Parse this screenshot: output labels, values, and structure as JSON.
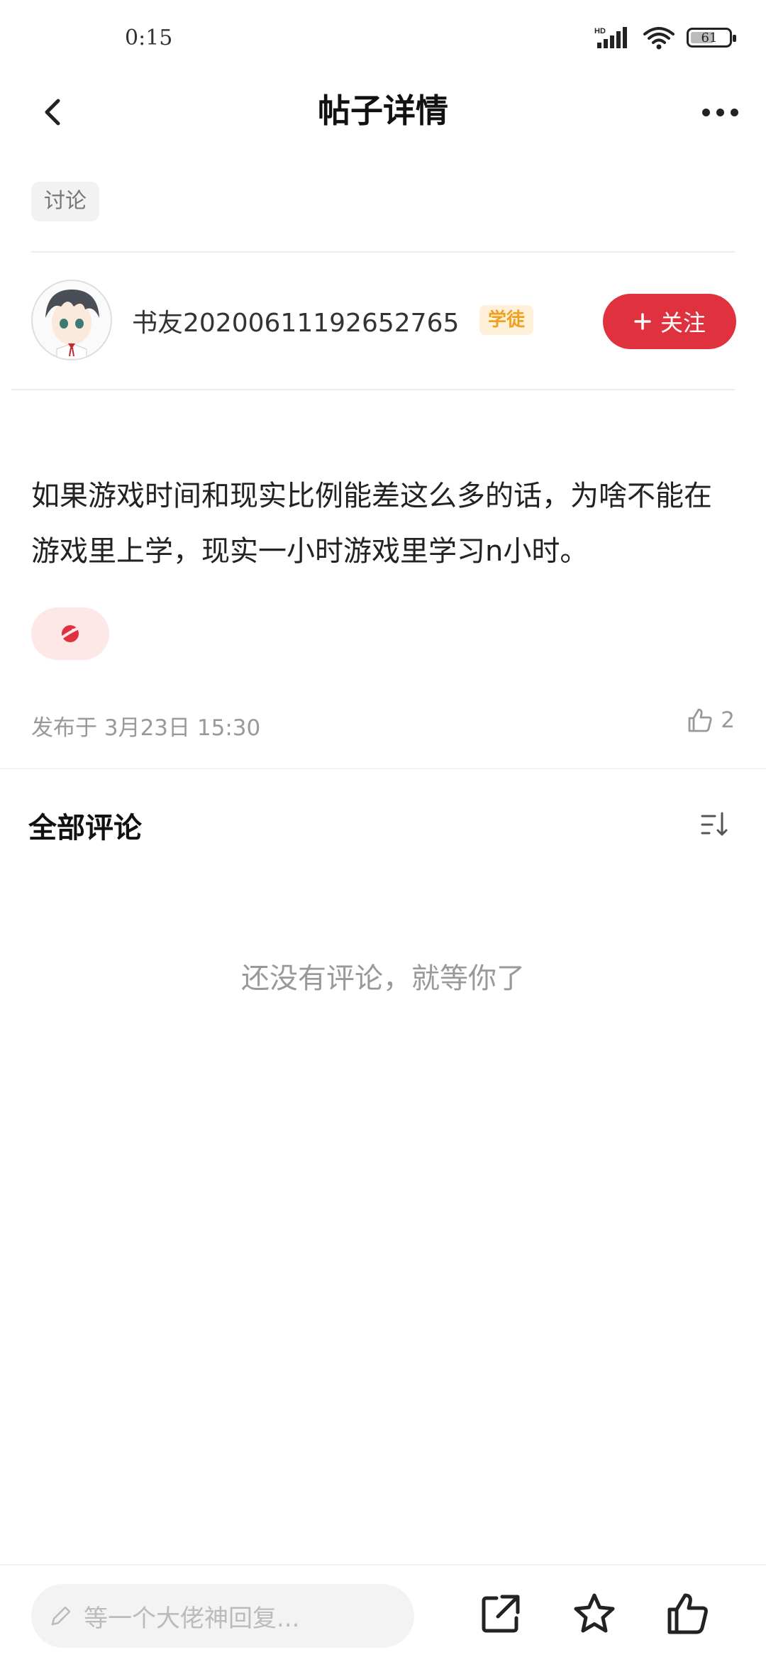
{
  "status_bar": {
    "time": "0:15",
    "network_label": "HD",
    "battery": "61",
    "battery_level": 0.61
  },
  "header": {
    "title": "帖子详情"
  },
  "post": {
    "tag": "讨论",
    "author": {
      "name": "书友20200611192652765",
      "badge": "学徒",
      "follow_label": "关注"
    },
    "content": "如果游戏时间和现实比例能差这么多的话，为啥不能在游戏里上学，现实一小时游戏里学习n小时。",
    "published": "发布于 3月23日 15:30",
    "like_count": "2"
  },
  "comments": {
    "title": "全部评论",
    "empty_text": "还没有评论，就等你了"
  },
  "bottom_bar": {
    "input_placeholder": "等一个大佬神回复..."
  },
  "colors": {
    "accent": "#e0313f",
    "badge_text": "#f0a020",
    "badge_bg": "#fff1d9",
    "topic_bg": "#fde7e7"
  },
  "icons": [
    "back-arrow-icon",
    "more-dots-icon",
    "sort-icon",
    "thumbs-up-icon",
    "pencil-icon",
    "share-icon",
    "star-icon",
    "like-icon",
    "planet-icon"
  ]
}
